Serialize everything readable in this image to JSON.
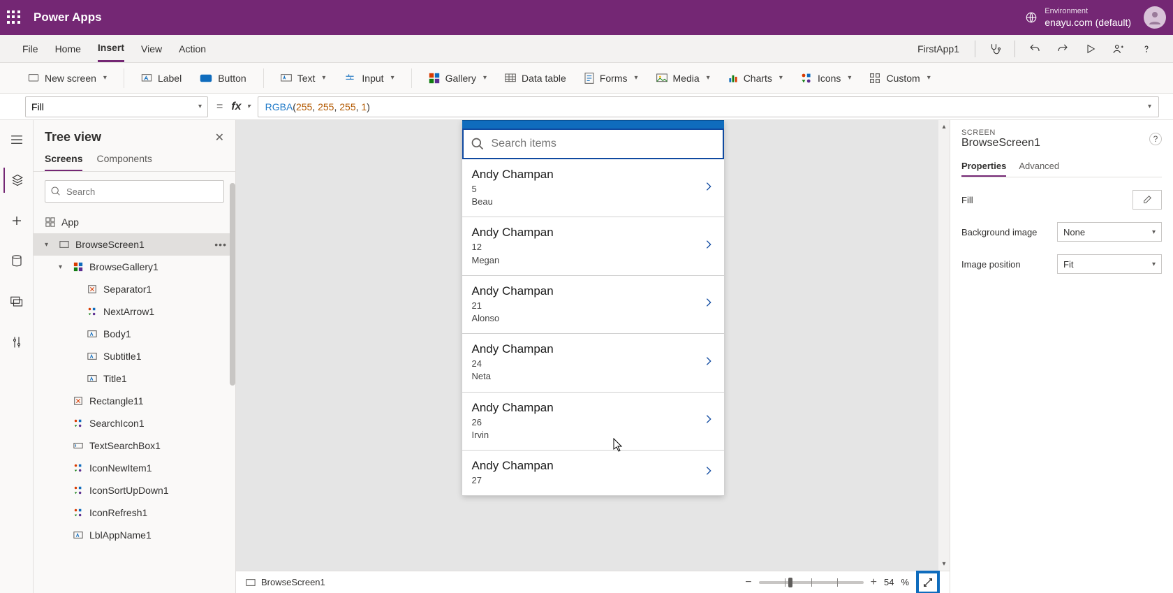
{
  "titlebar": {
    "product": "Power Apps",
    "env_label": "Environment",
    "env_name": "enayu.com (default)"
  },
  "menubar": {
    "items": [
      "File",
      "Home",
      "Insert",
      "View",
      "Action"
    ],
    "active_index": 2,
    "app_name": "FirstApp1"
  },
  "toolbar": {
    "new_screen": "New screen",
    "label": "Label",
    "button": "Button",
    "text": "Text",
    "input": "Input",
    "gallery": "Gallery",
    "data_table": "Data table",
    "forms": "Forms",
    "media": "Media",
    "charts": "Charts",
    "icons": "Icons",
    "custom": "Custom"
  },
  "formula": {
    "property": "Fill",
    "fn": "RGBA",
    "args": [
      "255",
      "255",
      "255",
      "1"
    ]
  },
  "tree": {
    "title": "Tree view",
    "tabs": {
      "screens": "Screens",
      "components": "Components"
    },
    "search_placeholder": "Search",
    "nodes": {
      "app": "App",
      "browse_screen": "BrowseScreen1",
      "browse_gallery": "BrowseGallery1",
      "separator": "Separator1",
      "next_arrow": "NextArrow1",
      "body": "Body1",
      "subtitle": "Subtitle1",
      "title": "Title1",
      "rectangle": "Rectangle11",
      "search_icon": "SearchIcon1",
      "text_search": "TextSearchBox1",
      "icon_new": "IconNewItem1",
      "icon_sort": "IconSortUpDown1",
      "icon_refresh": "IconRefresh1",
      "lbl_app_name": "LblAppName1"
    }
  },
  "phone": {
    "search_placeholder": "Search items",
    "items": [
      {
        "title": "Andy Champan",
        "sub1": "5",
        "sub2": "Beau"
      },
      {
        "title": "Andy Champan",
        "sub1": "12",
        "sub2": "Megan"
      },
      {
        "title": "Andy Champan",
        "sub1": "21",
        "sub2": "Alonso"
      },
      {
        "title": "Andy Champan",
        "sub1": "24",
        "sub2": "Neta"
      },
      {
        "title": "Andy Champan",
        "sub1": "26",
        "sub2": "Irvin"
      },
      {
        "title": "Andy Champan",
        "sub1": "27",
        "sub2": ""
      }
    ]
  },
  "right_panel": {
    "meta": "SCREEN",
    "title": "BrowseScreen1",
    "tabs": {
      "properties": "Properties",
      "advanced": "Advanced"
    },
    "rows": {
      "fill": "Fill",
      "bg_image": "Background image",
      "bg_image_val": "None",
      "img_pos": "Image position",
      "img_pos_val": "Fit"
    }
  },
  "status": {
    "screen": "BrowseScreen1",
    "zoom": "54",
    "zoom_suffix": "%"
  }
}
